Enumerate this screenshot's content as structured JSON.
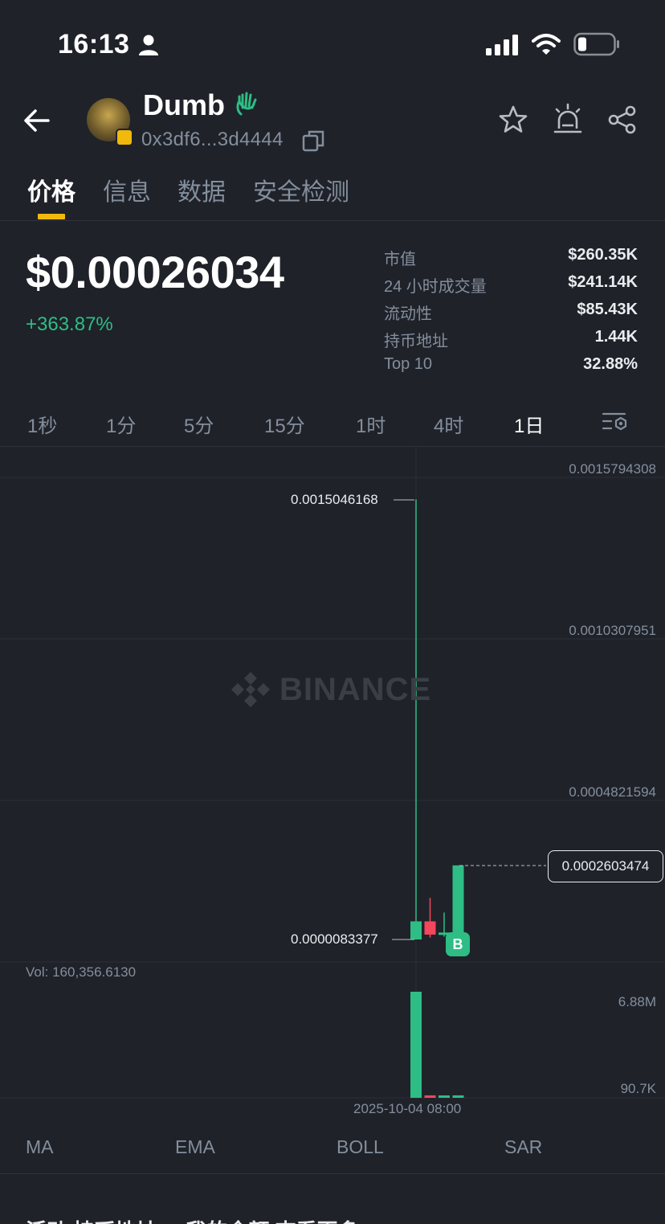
{
  "status_bar": {
    "time": "16:13"
  },
  "header": {
    "token_name": "Dumb",
    "token_address": "0x3df6...3d4444"
  },
  "tabs": [
    {
      "label": "价格",
      "active": true
    },
    {
      "label": "信息",
      "active": false
    },
    {
      "label": "数据",
      "active": false
    },
    {
      "label": "安全检测",
      "active": false
    }
  ],
  "price_panel": {
    "price": "$0.00026034",
    "change": "+363.87%",
    "stats": [
      {
        "label": "市值",
        "value": "$260.35K"
      },
      {
        "label": "24 小时成交量",
        "value": "$241.14K"
      },
      {
        "label": "流动性",
        "value": "$85.43K"
      },
      {
        "label": "持币地址",
        "value": "1.44K"
      },
      {
        "label": "Top 10",
        "value": "32.88%"
      }
    ]
  },
  "intervals": [
    {
      "label": "1秒",
      "active": false
    },
    {
      "label": "1分",
      "active": false
    },
    {
      "label": "5分",
      "active": false
    },
    {
      "label": "15分",
      "active": false
    },
    {
      "label": "1时",
      "active": false
    },
    {
      "label": "4时",
      "active": false
    },
    {
      "label": "1日",
      "active": true
    }
  ],
  "chart": {
    "watermark": "BINANCE",
    "y_ticks": [
      "0.0015794308",
      "0.0010307951",
      "0.0004821594"
    ],
    "high_label": "0.0015046168",
    "low_label": "0.0000083377",
    "current_label": "0.0002603474",
    "trade_marker": "B",
    "volume_label": "Vol: 160,356.6130",
    "volume_ticks": [
      "6.88M",
      "90.7K"
    ],
    "x_label": "2025-10-04 08:00"
  },
  "chart_data": {
    "type": "candlestick",
    "y_range": [
      8.3377e-06,
      0.0015794308
    ],
    "candles": [
      {
        "open": 8.3377e-06,
        "high": 0.0015046168,
        "low": 8.3377e-06,
        "close": 7e-05,
        "volume": 6880000
      },
      {
        "open": 7e-05,
        "high": 0.00015,
        "low": 1.5e-05,
        "close": 2.5e-05,
        "volume": 160000
      },
      {
        "open": 2.5e-05,
        "high": 0.0001,
        "low": 1.8e-05,
        "close": 3.2e-05,
        "volume": 40000
      },
      {
        "open": 3.2e-05,
        "high": 0.0002603474,
        "low": 3e-05,
        "close": 0.0002603474,
        "volume": 160356.613
      }
    ],
    "colors": {
      "up": "#2ebd85",
      "down": "#f6465d"
    }
  },
  "indicators": [
    "MA",
    "EMA",
    "BOLL",
    "SAR"
  ],
  "bottom_peek": "活动  持币地址 ...  我的余额  查看更多"
}
